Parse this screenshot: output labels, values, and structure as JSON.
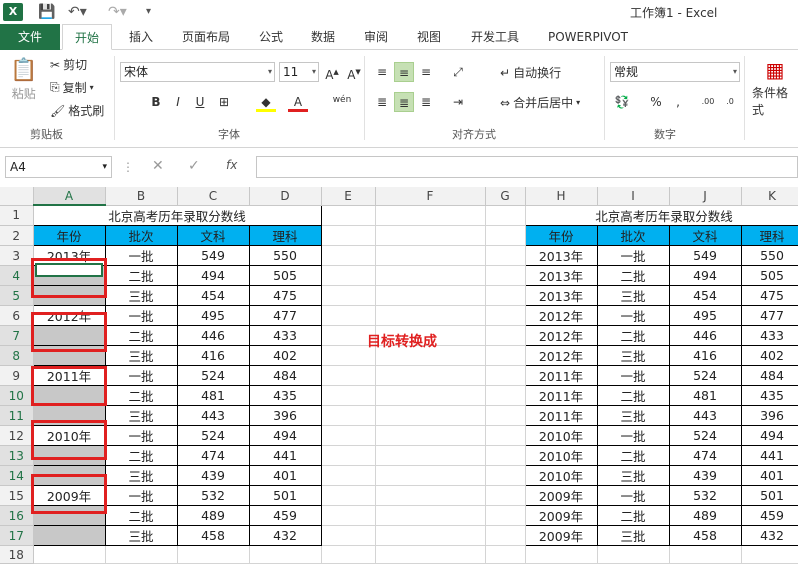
{
  "window": {
    "title": "工作簿1 - Excel",
    "app_icon": "X"
  },
  "ribbon_tabs": [
    "文件",
    "开始",
    "插入",
    "页面布局",
    "公式",
    "数据",
    "审阅",
    "视图",
    "开发工具",
    "POWERPIVOT"
  ],
  "clipboard": {
    "paste": "粘贴",
    "cut": "剪切",
    "copy": "复制",
    "format_painter": "格式刷",
    "group": "剪贴板"
  },
  "font": {
    "name": "宋体",
    "size": "11",
    "group": "字体",
    "wen": "wén"
  },
  "alignment": {
    "wrap": "自动换行",
    "merge": "合并后居中",
    "group": "对齐方式"
  },
  "number": {
    "format": "常规",
    "group": "数字"
  },
  "styles": {
    "cond": "条件格式"
  },
  "formula_bar": {
    "cell_ref": "A4",
    "fx": "fx",
    "content": ""
  },
  "col_headers": [
    "A",
    "B",
    "C",
    "D",
    "E",
    "F",
    "G",
    "H",
    "I",
    "J",
    "K"
  ],
  "left_table": {
    "title": "北京高考历年录取分数线",
    "headers": [
      "年份",
      "批次",
      "文科",
      "理科"
    ],
    "rows": [
      [
        "2013年",
        "一批",
        "549",
        "550"
      ],
      [
        "",
        "二批",
        "494",
        "505"
      ],
      [
        "",
        "三批",
        "454",
        "475"
      ],
      [
        "2012年",
        "一批",
        "495",
        "477"
      ],
      [
        "",
        "二批",
        "446",
        "433"
      ],
      [
        "",
        "三批",
        "416",
        "402"
      ],
      [
        "2011年",
        "一批",
        "524",
        "484"
      ],
      [
        "",
        "二批",
        "481",
        "435"
      ],
      [
        "",
        "三批",
        "443",
        "396"
      ],
      [
        "2010年",
        "一批",
        "524",
        "494"
      ],
      [
        "",
        "二批",
        "474",
        "441"
      ],
      [
        "",
        "三批",
        "439",
        "401"
      ],
      [
        "2009年",
        "一批",
        "532",
        "501"
      ],
      [
        "",
        "二批",
        "489",
        "459"
      ],
      [
        "",
        "三批",
        "458",
        "432"
      ]
    ]
  },
  "right_table": {
    "title": "北京高考历年录取分数线",
    "headers": [
      "年份",
      "批次",
      "文科",
      "理科"
    ],
    "rows": [
      [
        "2013年",
        "一批",
        "549",
        "550"
      ],
      [
        "2013年",
        "二批",
        "494",
        "505"
      ],
      [
        "2013年",
        "三批",
        "454",
        "475"
      ],
      [
        "2012年",
        "一批",
        "495",
        "477"
      ],
      [
        "2012年",
        "二批",
        "446",
        "433"
      ],
      [
        "2012年",
        "三批",
        "416",
        "402"
      ],
      [
        "2011年",
        "一批",
        "524",
        "484"
      ],
      [
        "2011年",
        "二批",
        "481",
        "435"
      ],
      [
        "2011年",
        "三批",
        "443",
        "396"
      ],
      [
        "2010年",
        "一批",
        "524",
        "494"
      ],
      [
        "2010年",
        "二批",
        "474",
        "441"
      ],
      [
        "2010年",
        "三批",
        "439",
        "401"
      ],
      [
        "2009年",
        "一批",
        "532",
        "501"
      ],
      [
        "2009年",
        "二批",
        "489",
        "459"
      ],
      [
        "2009年",
        "三批",
        "458",
        "432"
      ]
    ]
  },
  "annotation": "目标转换成",
  "row_numbers": [
    "1",
    "2",
    "3",
    "4",
    "5",
    "6",
    "7",
    "8",
    "9",
    "10",
    "11",
    "12",
    "13",
    "14",
    "15",
    "16",
    "17",
    "18"
  ],
  "colors": {
    "excel_green": "#217346",
    "header_blue": "#00b0f0",
    "highlight_red": "#e02020",
    "empty_gray": "#c8c8c8"
  }
}
